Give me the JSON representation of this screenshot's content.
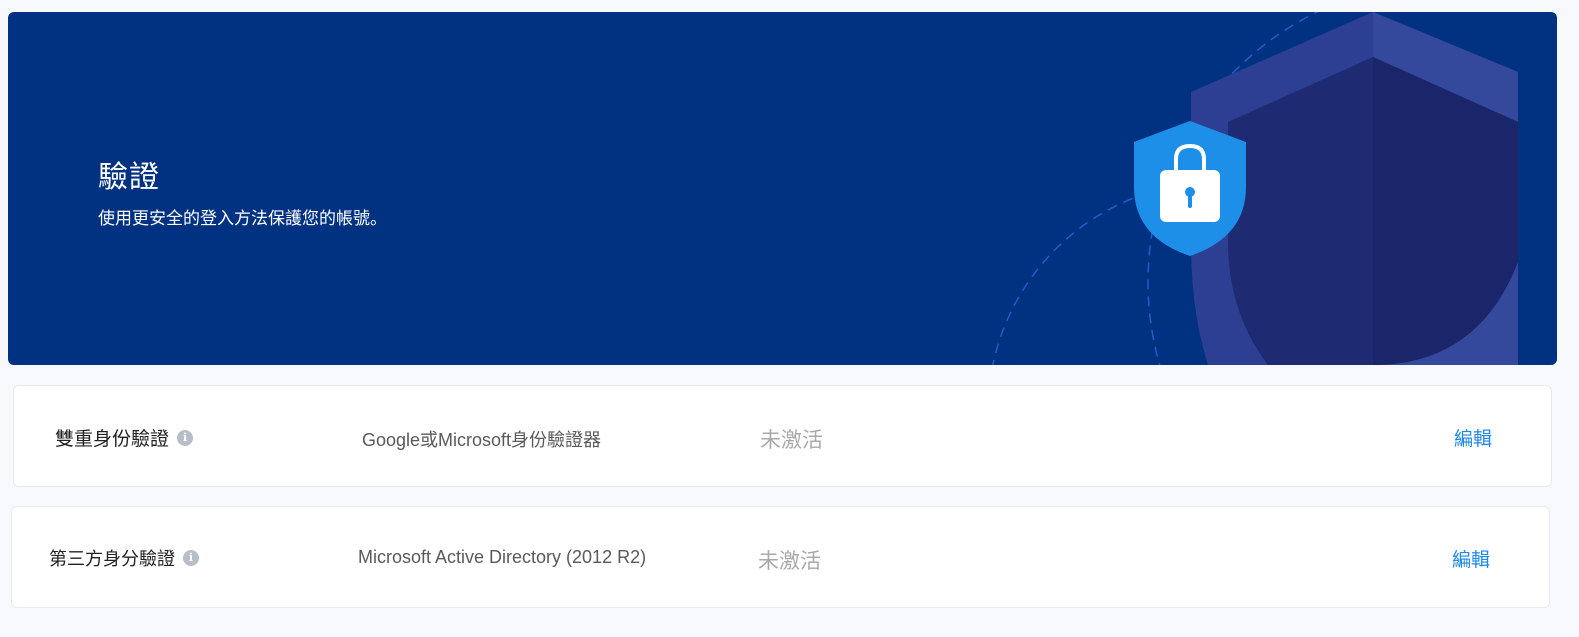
{
  "hero": {
    "title": "驗證",
    "subtitle": "使用更安全的登入方法保護您的帳號。",
    "icon": "shield-lock-icon",
    "colors": {
      "background": "#013282",
      "shield_accent": "#1e8fe8"
    }
  },
  "auth_rows": [
    {
      "label": "雙重身份驗證",
      "info_icon": "info-icon",
      "method": "Google或Microsoft身份驗證器",
      "status": "未激活",
      "action": "編輯"
    },
    {
      "label": "第三方身分驗證",
      "info_icon": "info-icon",
      "method": "Microsoft Active Directory (2012 R2)",
      "status": "未激活",
      "action": "編輯"
    }
  ],
  "colors": {
    "link": "#1e88e5",
    "status_inactive": "#a9a9a9"
  }
}
